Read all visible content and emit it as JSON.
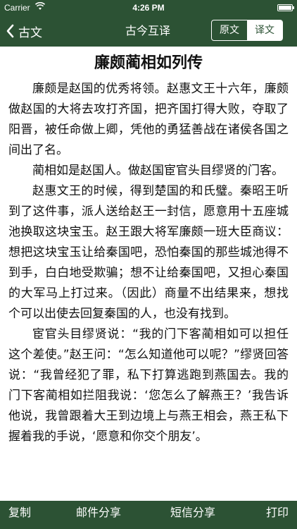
{
  "status_bar": {
    "carrier": "Carrier",
    "time": "4:26 PM"
  },
  "nav": {
    "back_label": "古文",
    "title": "古今互译",
    "segments": [
      "原文",
      "译文"
    ],
    "selected_segment": "原文"
  },
  "article": {
    "title": "廉颇蔺相如列传",
    "paragraphs": [
      "廉颇是赵国的优秀将领。赵惠文王十六年，廉颇做赵国的大将去攻打齐国，把齐国打得大败，夺取了阳晋，被任命做上卿，凭他的勇猛善战在诸侯各国之间出了名。",
      "蔺相如是赵国人。做赵国宦官头目缪贤的门客。",
      "赵惠文王的时候，得到楚国的和氏璧。秦昭王听到了这件事，派人送给赵王一封信，愿意用十五座城池换取这块宝玉。赵王跟大将军廉颇一班大臣商议：想把这块宝玉让给秦国吧，恐怕秦国的那些城池得不到手，白白地受欺骗；想不让给秦国吧，又担心秦国的大军马上打过来。（因此）商量不出结果来，想找个可以出使去回复秦国的人，也没有找到。",
      "宦官头目缪贤说：“我的门下客蔺相如可以担任这个差使。”赵王问：“怎么知道他可以呢？”缪贤回答说：“我曾经犯了罪，私下打算逃跑到燕国去。我的门下客蔺相如拦阻我说：‘您怎么了解燕王？’我告诉他说，我曾跟着大王到边境上与燕王相会，燕王私下握着我的手说，‘愿意和你交个朋友’。"
    ]
  },
  "toolbar": {
    "copy": "复制",
    "mail_share": "邮件分享",
    "sms_share": "短信分享",
    "print": "打印"
  },
  "colors": {
    "bar_green": "#2c5234",
    "text": "#111111",
    "background": "#ffffff"
  }
}
